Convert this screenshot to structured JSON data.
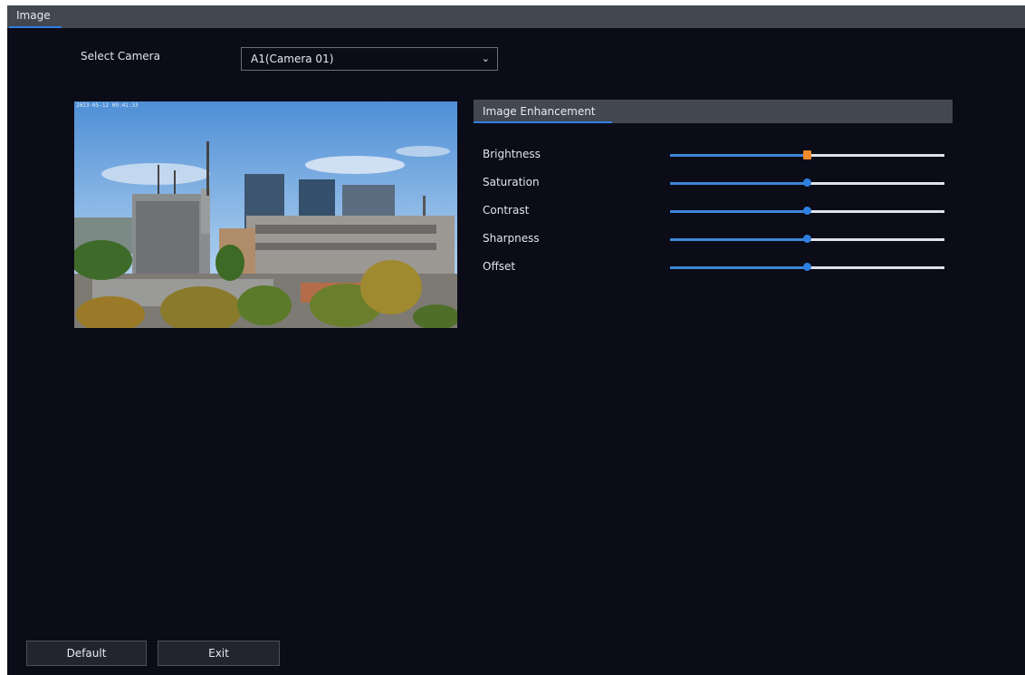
{
  "window": {
    "tab_label": "Image"
  },
  "camera_select": {
    "label": "Select Camera",
    "value": "A1(Camera 01)",
    "chevron_icon": "chevron-down-icon"
  },
  "preview": {
    "osd_text": "2023-05-12 09:41:33"
  },
  "enhancement": {
    "title": "Image Enhancement",
    "sliders": [
      {
        "label": "Brightness",
        "value": 0.5,
        "active": true
      },
      {
        "label": "Saturation",
        "value": 0.5,
        "active": false
      },
      {
        "label": "Contrast",
        "value": 0.5,
        "active": false
      },
      {
        "label": "Sharpness",
        "value": 0.5,
        "active": false
      },
      {
        "label": "Offset",
        "value": 0.5,
        "active": false
      }
    ]
  },
  "buttons": {
    "default_label": "Default",
    "exit_label": "Exit"
  },
  "colors": {
    "background": "#0b0c18",
    "header": "#43474f",
    "accent": "#2f7fe0",
    "active_handle": "#f08a2c"
  }
}
